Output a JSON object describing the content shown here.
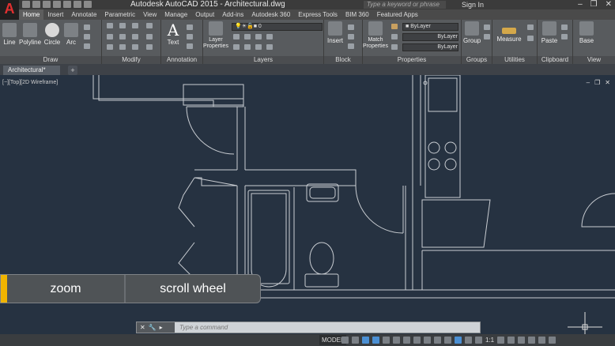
{
  "app": {
    "logo": "A",
    "title": "Autodesk AutoCAD 2015 - Architectural.dwg",
    "search_placeholder": "Type a keyword or phrase",
    "signin": "Sign In"
  },
  "tabs": [
    "Home",
    "Insert",
    "Annotate",
    "Parametric",
    "View",
    "Manage",
    "Output",
    "Add-ins",
    "Autodesk 360",
    "Express Tools",
    "BIM 360",
    "Featured Apps"
  ],
  "ribbon": {
    "draw": {
      "title": "Draw",
      "line": "Line",
      "polyline": "Polyline",
      "circle": "Circle",
      "arc": "Arc"
    },
    "modify": {
      "title": "Modify"
    },
    "annotation": {
      "title": "Annotation",
      "text": "Text"
    },
    "layers": {
      "title": "Layers",
      "layer_properties": "Layer Properties",
      "current_layer": "0"
    },
    "block": {
      "title": "Block",
      "insert": "Insert"
    },
    "properties": {
      "title": "Properties",
      "match_properties": "Match Properties",
      "bylayer1": "ByLayer",
      "bylayer2": "ByLayer",
      "bylayer3": "ByLayer"
    },
    "groups": {
      "title": "Groups",
      "group": "Group"
    },
    "utilities": {
      "title": "Utilities",
      "measure": "Measure"
    },
    "clipboard": {
      "title": "Clipboard",
      "paste": "Paste"
    },
    "view": {
      "title": "View",
      "base": "Base"
    }
  },
  "document": {
    "tab": "Architectural*",
    "viewport_label": "[−][Top][2D Wireframe]"
  },
  "overlay": {
    "key1": "zoom",
    "key2": "scroll wheel"
  },
  "command": {
    "placeholder": "Type a command"
  },
  "status": {
    "model": "MODEL",
    "scale": "1:1"
  }
}
